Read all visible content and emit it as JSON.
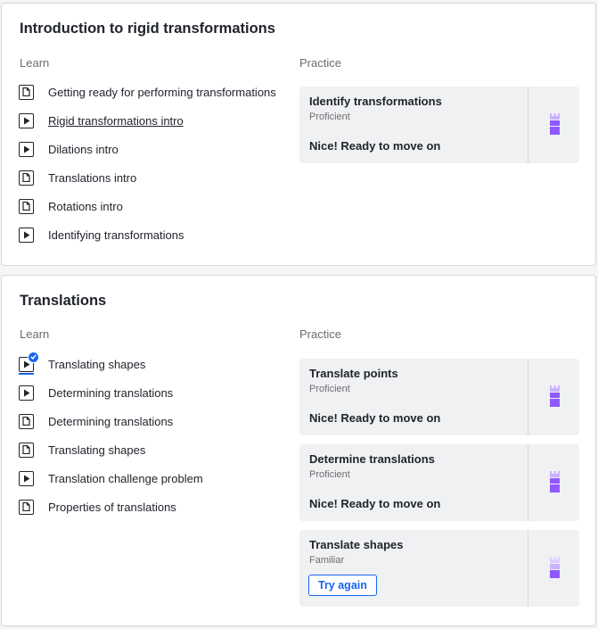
{
  "units": [
    {
      "title": "Introduction to rigid transformations",
      "learn_label": "Learn",
      "practice_label": "Practice",
      "learn_items": [
        {
          "label": "Getting ready for performing transformations",
          "icon": "article-icon"
        },
        {
          "label": "Rigid transformations intro",
          "icon": "video-icon"
        },
        {
          "label": "Dilations intro",
          "icon": "video-icon"
        },
        {
          "label": "Translations intro",
          "icon": "article-icon"
        },
        {
          "label": "Rotations intro",
          "icon": "article-icon"
        },
        {
          "label": "Identifying transformations",
          "icon": "video-icon"
        }
      ],
      "practice": [
        {
          "title": "Identify transformations",
          "level": "Proficient",
          "status": "Nice! Ready to move on"
        }
      ]
    },
    {
      "title": "Translations",
      "learn_label": "Learn",
      "practice_label": "Practice",
      "learn_items": [
        {
          "label": "Translating shapes",
          "icon": "video-icon",
          "completed": true
        },
        {
          "label": "Determining translations",
          "icon": "video-icon"
        },
        {
          "label": "Determining translations",
          "icon": "article-icon"
        },
        {
          "label": "Translating shapes",
          "icon": "article-icon"
        },
        {
          "label": "Translation challenge problem",
          "icon": "video-icon"
        },
        {
          "label": "Properties of translations",
          "icon": "article-icon"
        }
      ],
      "practice": [
        {
          "title": "Translate points",
          "level": "Proficient",
          "status": "Nice! Ready to move on"
        },
        {
          "title": "Determine translations",
          "level": "Proficient",
          "status": "Nice! Ready to move on"
        },
        {
          "title": "Translate shapes",
          "level": "Familiar",
          "button": "Try again"
        }
      ]
    }
  ],
  "colors": {
    "mastery_purple": "#9059ff",
    "mastery_light": "#c9b3ff",
    "link_blue": "#1865f2"
  }
}
